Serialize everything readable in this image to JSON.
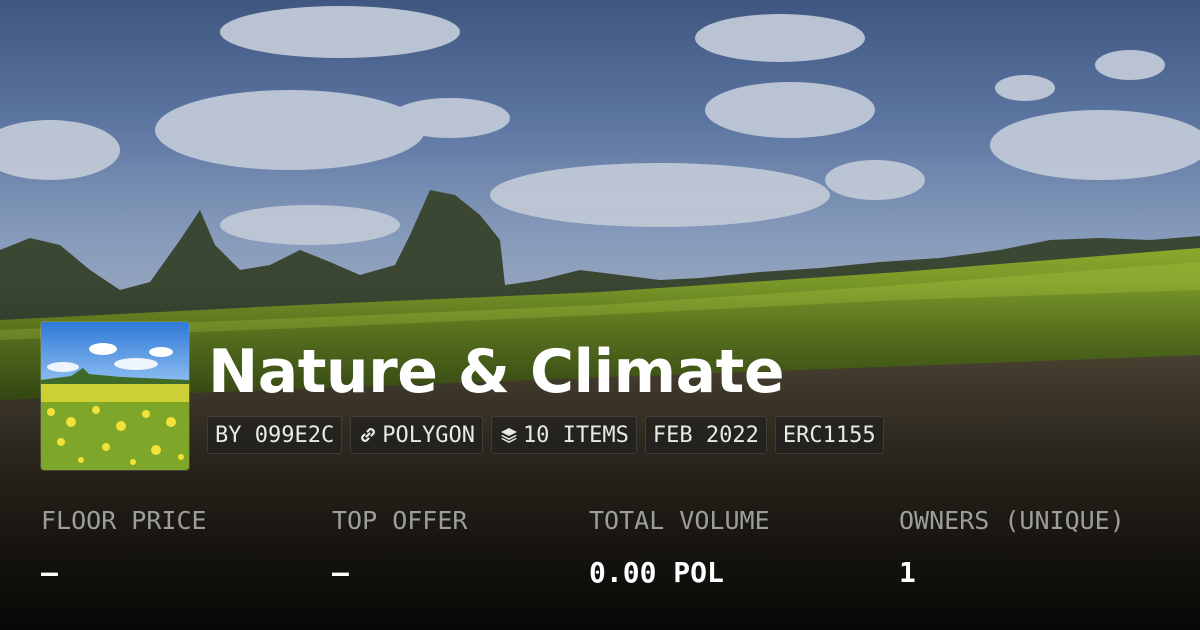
{
  "collection": {
    "title": "Nature & Climate",
    "chips": {
      "creator": "BY 099E2C",
      "chain": "POLYGON",
      "items": "10 ITEMS",
      "date": "FEB 2022",
      "standard": "ERC1155"
    }
  },
  "stats": {
    "floor_price": {
      "label": "FLOOR PRICE",
      "value": "–"
    },
    "top_offer": {
      "label": "TOP OFFER",
      "value": "–"
    },
    "total_volume": {
      "label": "TOTAL VOLUME",
      "value": "0.00 POL"
    },
    "owners": {
      "label": "OWNERS (UNIQUE)",
      "value": "1"
    }
  },
  "icons": {
    "chain": "link-icon",
    "items": "layers-icon"
  },
  "colors": {
    "text_primary": "#ffffff",
    "text_muted": "#9d9d9d",
    "field_green": "#7fa427",
    "sky_blue": "#5f7aa6"
  }
}
